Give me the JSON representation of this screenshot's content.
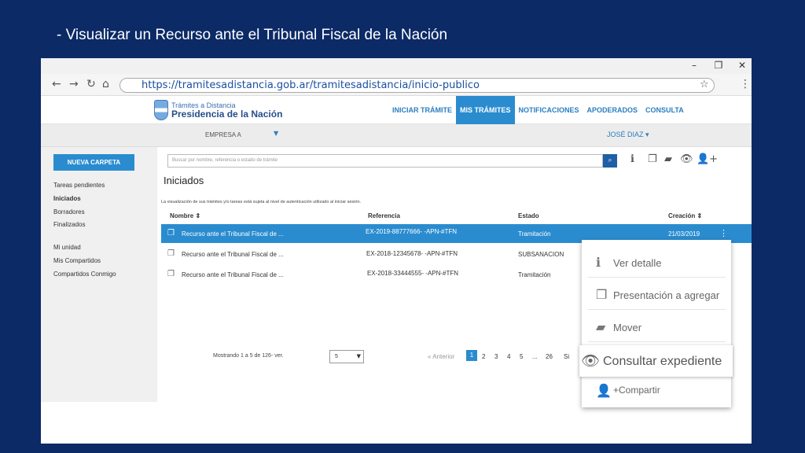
{
  "slide": {
    "title": "- Visualizar un Recurso ante el Tribunal Fiscal de la Nación"
  },
  "window": {
    "minimize": "–",
    "restore": "❐",
    "close": "✕"
  },
  "browser": {
    "back": "←",
    "forward": "→",
    "reload": "↻",
    "home": "⌂",
    "url": "https://tramitesadistancia.gob.ar/tramitesadistancia/inicio-publico",
    "star": "☆",
    "menu": "⋮"
  },
  "site": {
    "logo_line1": "Trámites a Distancia",
    "logo_line2": "Presidencia de la Nación",
    "nav": [
      {
        "label": "INICIAR TRÁMITE",
        "active": false
      },
      {
        "label": "MIS TRÁMITES",
        "active": true
      },
      {
        "label": "NOTIFICACIONES",
        "active": false
      },
      {
        "label": "APODERADOS",
        "active": false
      },
      {
        "label": "CONSULTA",
        "active": false
      }
    ],
    "company": "EMPRESA A",
    "company_caret": "▼",
    "user": "JOSÉ DIAZ ▾"
  },
  "sidebar": {
    "new_folder": "NUEVA CARPETA",
    "items": [
      "Tareas pendientes",
      "Iniciados",
      "Borradores",
      "Finalizados"
    ],
    "items2": [
      "Mi unidad",
      "Mis Compartidos",
      "Compartidos Conmigo"
    ]
  },
  "main": {
    "search_placeholder": "Buscar por nombre, referencia o estado de trámite",
    "search_icon": "⌕",
    "tools": [
      "ℹ",
      "❐",
      "▰",
      "👁",
      "👤+"
    ],
    "section_title": "Iniciados",
    "notice": "La visualización de sus trámites y/o tareas está sujeta al nivel de autenticación utilizado al iniciar sesión.",
    "headers": {
      "nombre": "Nombre ⇕",
      "referencia": "Referencia",
      "estado": "Estado",
      "creacion": "Creación ⇕"
    },
    "rows": [
      {
        "nombre": "Recurso ante el Tribunal Fiscal de ...",
        "referencia": "EX-2019-88777666- -APN-#TFN",
        "estado": "Tramitación",
        "creacion": "21/03/2019",
        "icon": "❐"
      },
      {
        "nombre": "Recurso ante el Tribunal Fiscal de ...",
        "referencia": "EX-2018-12345678- -APN-#TFN",
        "estado": "SUBSANACION",
        "creacion": "",
        "icon": "❐"
      },
      {
        "nombre": "Recurso ante el Tribunal Fiscal de ...",
        "referencia": "EX-2018-33444555- -APN-#TFN",
        "estado": "Tramitación",
        "creacion": "",
        "icon": "❐"
      }
    ],
    "kebab": "⋮"
  },
  "pager": {
    "text": "Mostrando 1 a 5 de 126- ver.",
    "page_size": "5",
    "caret": "▼",
    "prev": "« Anterior",
    "pages": [
      "1",
      "2",
      "3",
      "4",
      "5",
      "...",
      "26",
      "Si"
    ]
  },
  "context_menu": {
    "items": [
      {
        "icon": "ℹ",
        "label": "Ver detalle"
      },
      {
        "icon": "❐",
        "label": "Presentación a agregar"
      },
      {
        "icon": "▰",
        "label": "Mover"
      }
    ],
    "highlight": {
      "icon": "👁",
      "label": "Consultar expediente"
    },
    "last": {
      "icon": "👤",
      "label": "+Compartir"
    }
  }
}
